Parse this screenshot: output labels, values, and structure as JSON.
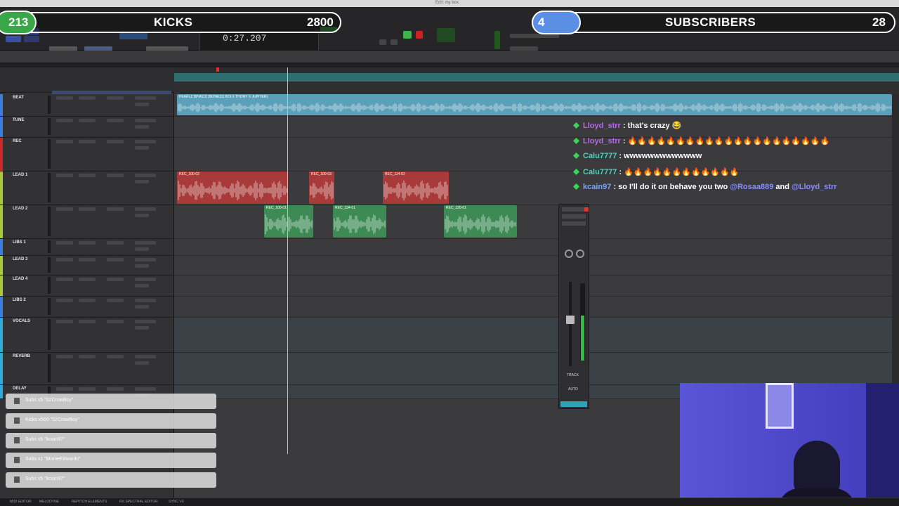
{
  "window": {
    "title": "Edit: my box"
  },
  "counters": {
    "kicks": {
      "count": "213",
      "label": "KICKS",
      "goal": "2800"
    },
    "subs": {
      "count": "4",
      "label": "SUBSCRIBERS",
      "goal": "28"
    }
  },
  "transport": {
    "main_counter": "0:27.207"
  },
  "tracks": [
    {
      "name": "BEAT",
      "color": "#3c7de0"
    },
    {
      "name": "TUNE",
      "color": "#3c7de0"
    },
    {
      "name": "REC",
      "color": "#cc2a2a"
    },
    {
      "name": "LEAD 1",
      "color": "#a8c93a"
    },
    {
      "name": "LEAD 2",
      "color": "#a8c93a"
    },
    {
      "name": "LIBS 1",
      "color": "#3c7de0"
    },
    {
      "name": "LEAD 3",
      "color": "#a8c93a"
    },
    {
      "name": "LEAD 4",
      "color": "#a8c93a"
    },
    {
      "name": "LIBS 2",
      "color": "#3c7de0"
    },
    {
      "name": "VOCALS",
      "color": "#2fa9d6"
    },
    {
      "name": "REVERB",
      "color": "#2fa9d6"
    },
    {
      "name": "DELAY",
      "color": "#2fa9d6"
    }
  ],
  "clips": [
    {
      "name": "PEARLZ BPM119 (BIZNESS BOI X THONY X JUPITER)",
      "color": "#5aa0b8"
    },
    {
      "name": "REC_100-02",
      "color": "#a83a3a"
    },
    {
      "name": "REC_100-03",
      "color": "#a83a3a"
    },
    {
      "name": "REC_114-02",
      "color": "#a83a3a"
    },
    {
      "name": "REC_100-01",
      "color": "#3d8a55"
    },
    {
      "name": "REC_134-01",
      "color": "#3d8a55"
    },
    {
      "name": "REC_120-01",
      "color": "#3d8a55"
    }
  ],
  "chat": [
    {
      "user": "Lloyd_strr",
      "user_color": "#b46ae8",
      "message": ": that's crazy 😂"
    },
    {
      "user": "Lloyd_strr",
      "user_color": "#b46ae8",
      "message": ": 🔥🔥🔥🔥🔥🔥🔥🔥🔥🔥🔥🔥🔥🔥🔥🔥🔥🔥🔥🔥🔥"
    },
    {
      "user": "Calu7777",
      "user_color": "#4fd0c0",
      "message": ": wwwwwwwwwwwww"
    },
    {
      "user": "Calu7777",
      "user_color": "#4fd0c0",
      "message": ": 🔥🔥🔥🔥🔥🔥🔥🔥🔥🔥🔥🔥"
    },
    {
      "user": "kcain97",
      "user_color": "#7aa0ff",
      "message": ": so I'll do it on behave you two",
      "mention1": "@Rosaa889",
      "joiner": "and",
      "mention2": "@Lloyd_strr"
    }
  ],
  "alerts": [
    {
      "text": "Subs x5 \"02CrowBoy\""
    },
    {
      "text": "Kicks x500 \"02CrowBoy\""
    },
    {
      "text": "Subs x5 \"kcain97\""
    },
    {
      "text": "Subs x1 \"MonieEdwards\""
    },
    {
      "text": "Subs x5 \"kcain97\""
    }
  ],
  "bottom_bar": {
    "items": [
      "MIDI EDITOR",
      "MELODYNE",
      "REPITCH ELEMENTS",
      "RX SPECTRAL EDITOR",
      "SYNC VX"
    ]
  },
  "mixer": {
    "track_label": "TRACK",
    "auto_label": "AUTO"
  },
  "colors": {
    "accent_green": "#3aa64a",
    "counter_border": "#ffffff",
    "webcam_tint": "#4b47c9"
  }
}
